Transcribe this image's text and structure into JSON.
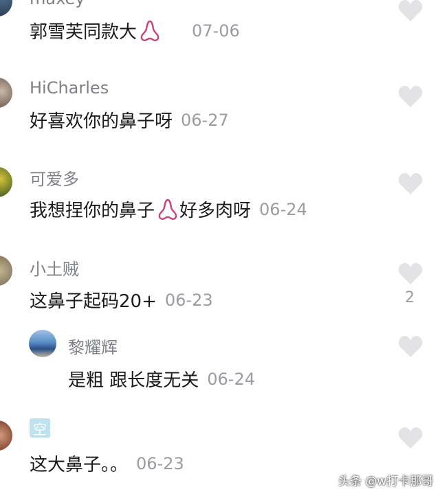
{
  "comments": [
    {
      "username": "maxey",
      "text": "郭雪芙同款大",
      "has_nose_icon": true,
      "date": "07-06"
    },
    {
      "username": "HiCharles",
      "text": "好喜欢你的鼻子呀",
      "date": "06-27"
    },
    {
      "username": "可爱多",
      "text": "我想捏你的鼻子",
      "has_nose_icon": true,
      "text_after": "好多肉呀",
      "date": "06-24"
    },
    {
      "username": "小土贼",
      "text": "这鼻子起码20+",
      "date": "06-23",
      "likes": "2"
    },
    {
      "username": "黎耀辉",
      "text": "是粗 跟长度无关",
      "date": "06-24",
      "is_reply": true
    },
    {
      "username_badge": "空",
      "text": "这大鼻子。。",
      "date": "06-23"
    }
  ],
  "watermark": "头条 @w打卡那哥",
  "colors": {
    "nose_icon": "#c9437a",
    "like_icon": "#e3e3e6",
    "username": "#7e8087",
    "date": "#9a9ca3"
  },
  "icons": {
    "like": "heart-icon",
    "emoji": "nose-emoji-icon"
  }
}
